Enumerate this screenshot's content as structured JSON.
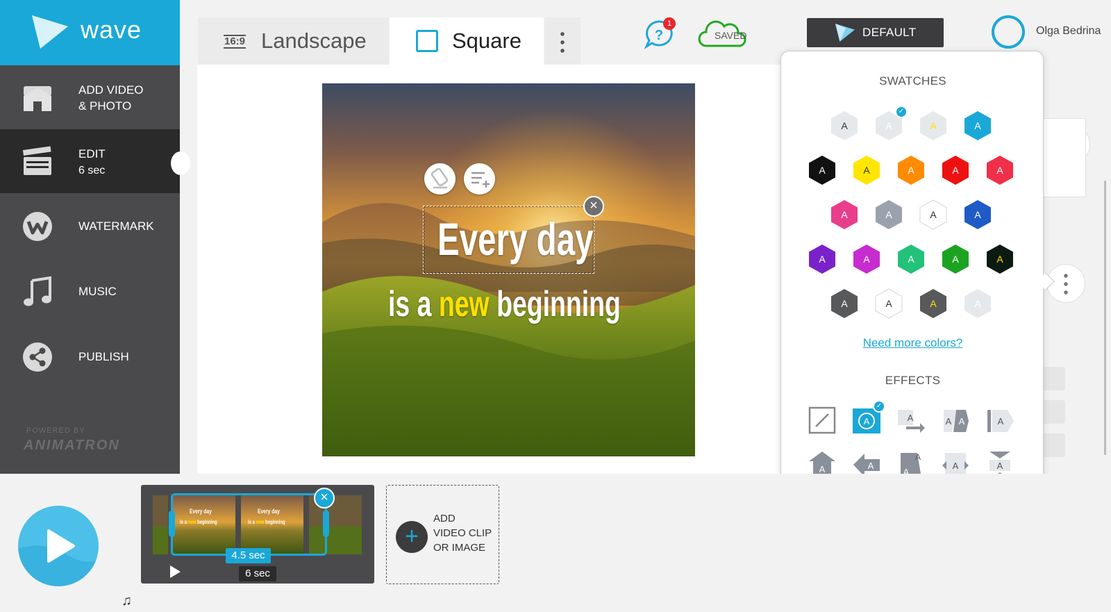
{
  "app": {
    "name": "wave",
    "powered_by": "POWERED BY",
    "powered_brand": "ANIMATRON"
  },
  "sidebar": {
    "items": [
      {
        "label": "ADD VIDEO",
        "label2": "& PHOTO",
        "icon": "home-photo-icon"
      },
      {
        "label": "EDIT",
        "label2": "6 sec",
        "icon": "clapperboard-icon",
        "active": true
      },
      {
        "label": "WATERMARK",
        "icon": "watermark-icon"
      },
      {
        "label": "MUSIC",
        "icon": "music-icon"
      },
      {
        "label": "PUBLISH",
        "icon": "share-icon"
      }
    ]
  },
  "topbar": {
    "tabs": [
      {
        "label": "Landscape",
        "icon_text": "16:9"
      },
      {
        "label": "Square",
        "active": true
      }
    ],
    "help_badge": "1",
    "saved_label": "SAVED",
    "theme_button": "DEFAULT",
    "user_name": "Olga Bedrina"
  },
  "canvas": {
    "line1": "Every day",
    "line2_a": "is a ",
    "line2_highlight": "new",
    "line2_b": " beginning",
    "highlight_color": "#ffe000"
  },
  "popover": {
    "swatches_title": "SWATCHES",
    "need_more_link": "Need more colors?",
    "effects_title": "EFFECTS",
    "swatch_letter": "A",
    "swatches": [
      [
        {
          "fill": "#e6e9ec",
          "text": "#333"
        },
        {
          "fill": "#e6e9ec",
          "text": "#ffffff",
          "selected": true
        },
        {
          "fill": "#e6e9ec",
          "text": "#ffe000"
        },
        {
          "fill": "#1aa8d8",
          "text": "#ffffff"
        }
      ],
      [
        {
          "fill": "#111111",
          "text": "#ffffff"
        },
        {
          "fill": "#ffe600",
          "text": "#333"
        },
        {
          "fill": "#ff8c00",
          "text": "#ffffff"
        },
        {
          "fill": "#ee1111",
          "text": "#ffffff"
        },
        {
          "fill": "#f0304a",
          "text": "#ffffff"
        }
      ],
      [
        {
          "fill": "#e83e8c",
          "text": "#ffffff"
        },
        {
          "fill": "#9aa3ad",
          "text": "#ffffff"
        },
        {
          "fill": "#ffffff",
          "text": "#333"
        },
        {
          "fill": "#1f5bc6",
          "text": "#ffffff"
        }
      ],
      [
        {
          "fill": "#7a22c9",
          "text": "#ffffff"
        },
        {
          "fill": "#c72ccf",
          "text": "#ffffff"
        },
        {
          "fill": "#22c27a",
          "text": "#ffffff"
        },
        {
          "fill": "#1ca322",
          "text": "#ffffff"
        },
        {
          "fill": "#0c1a12",
          "text": "#ffe000"
        }
      ],
      [
        {
          "fill": "#58595b",
          "text": "#ffffff"
        },
        {
          "fill": "#ffffff",
          "text": "#333"
        },
        {
          "fill": "#58595b",
          "text": "#ffe000"
        },
        {
          "fill": "#e6e9ec",
          "text": "#ffffff"
        }
      ]
    ],
    "effects": [
      [
        "none-effect-icon",
        "fade-effect-icon",
        "slide-right-effect-icon",
        "split-effect-icon",
        "push-right-effect-icon"
      ],
      [
        "rise-up-effect-icon",
        "arrow-left-effect-icon",
        "stagger-effect-icon",
        "spread-effect-icon",
        "unfold-vertical-effect-icon"
      ]
    ]
  },
  "timeline": {
    "clip_selected_duration": "4.5 sec",
    "clip_total_duration": "6 sec",
    "thumb_line1": "Every day",
    "thumb_line2_a": "is a ",
    "thumb_line2_highlight": "new",
    "thumb_line2_b": " beginning",
    "add_clip_label": "ADD VIDEO CLIP OR IMAGE",
    "add_clip_lines": [
      "ADD",
      "VIDEO CLIP",
      "OR IMAGE"
    ]
  },
  "colors": {
    "accent": "#1aa8d8",
    "sidebar": "#4a4a4c",
    "sidebar_active": "#2a2a2b",
    "saved_green": "#22aa22"
  }
}
